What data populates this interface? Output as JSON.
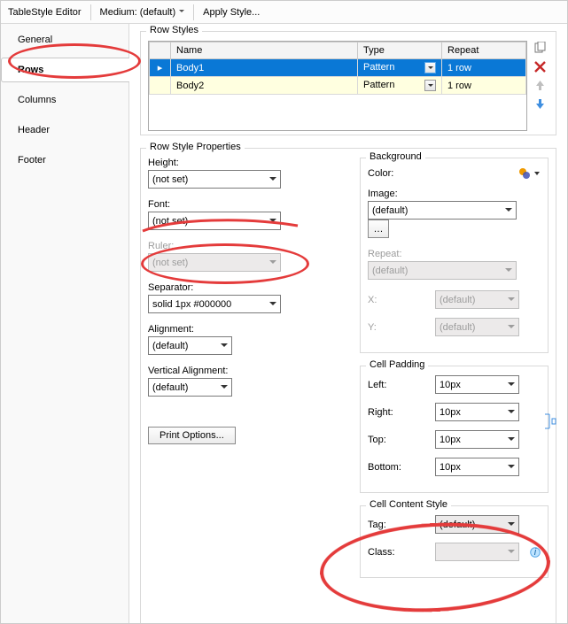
{
  "toolbar": {
    "title": "TableStyle Editor",
    "medium_label": "Medium: (default)",
    "apply_label": "Apply Style..."
  },
  "sidebar": {
    "tabs": [
      "General",
      "Rows",
      "Columns",
      "Header",
      "Footer"
    ],
    "active_index": 1
  },
  "row_styles": {
    "legend": "Row Styles",
    "columns": [
      "Name",
      "Type",
      "Repeat"
    ],
    "rows": [
      {
        "name": "Body1",
        "type": "Pattern",
        "repeat": "1 row",
        "selected": true
      },
      {
        "name": "Body2",
        "type": "Pattern",
        "repeat": "1 row",
        "selected": false
      }
    ],
    "icons": [
      "copy-icon",
      "delete-icon",
      "move-up-icon",
      "move-down-icon"
    ]
  },
  "row_style_properties": {
    "legend": "Row Style Properties",
    "height": {
      "label": "Height:",
      "value": "(not set)"
    },
    "font": {
      "label": "Font:",
      "value": "(not set)"
    },
    "ruler": {
      "label": "Ruler:",
      "value": "(not set)"
    },
    "separator": {
      "label": "Separator:",
      "value": "solid 1px #000000"
    },
    "alignment": {
      "label": "Alignment:",
      "value": "(default)"
    },
    "valignment": {
      "label": "Vertical Alignment:",
      "value": "(default)"
    },
    "print_options": "Print Options...",
    "background": {
      "legend": "Background",
      "color_label": "Color:",
      "image_label": "Image:",
      "image_value": "(default)",
      "repeat_label": "Repeat:",
      "repeat_value": "(default)",
      "x_label": "X:",
      "x_value": "(default)",
      "y_label": "Y:",
      "y_value": "(default)"
    },
    "cell_padding": {
      "legend": "Cell Padding",
      "left": {
        "label": "Left:",
        "value": "10px"
      },
      "right": {
        "label": "Right:",
        "value": "10px"
      },
      "top": {
        "label": "Top:",
        "value": "10px"
      },
      "bottom": {
        "label": "Bottom:",
        "value": "10px"
      }
    },
    "cell_content_style": {
      "legend": "Cell Content Style",
      "tag": {
        "label": "Tag:",
        "value": "(default)"
      },
      "class": {
        "label": "Class:",
        "value": ""
      }
    }
  }
}
